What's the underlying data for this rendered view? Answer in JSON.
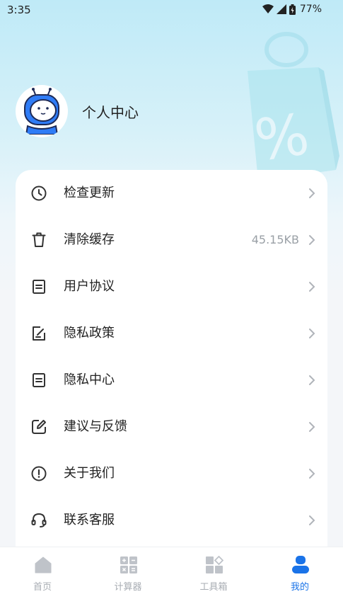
{
  "status_bar": {
    "time": "3:35",
    "battery": "77%"
  },
  "profile": {
    "name": "个人中心"
  },
  "menu": [
    {
      "label": "检查更新",
      "icon": "clock-icon",
      "value": ""
    },
    {
      "label": "清除缓存",
      "icon": "trash-icon",
      "value": "45.15KB"
    },
    {
      "label": "用户协议",
      "icon": "document-icon",
      "value": ""
    },
    {
      "label": "隐私政策",
      "icon": "edit-document-icon",
      "value": ""
    },
    {
      "label": "隐私中心",
      "icon": "document-icon",
      "value": ""
    },
    {
      "label": "建议与反馈",
      "icon": "feedback-edit-icon",
      "value": ""
    },
    {
      "label": "关于我们",
      "icon": "info-circle-icon",
      "value": ""
    },
    {
      "label": "联系客服",
      "icon": "headset-icon",
      "value": ""
    }
  ],
  "bottom_nav": [
    {
      "label": "首页",
      "icon": "home-icon",
      "active": false
    },
    {
      "label": "计算器",
      "icon": "calculator-icon",
      "active": false
    },
    {
      "label": "工具箱",
      "icon": "toolbox-icon",
      "active": false
    },
    {
      "label": "我的",
      "icon": "user-icon",
      "active": true
    }
  ],
  "colors": {
    "accent": "#1a73e8",
    "inactive": "#a8adb3",
    "header_bg": "#bfeaf7"
  }
}
